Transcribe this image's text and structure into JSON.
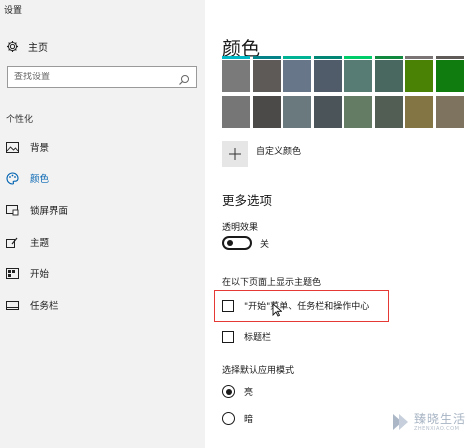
{
  "window": {
    "title": "设置"
  },
  "sidebar": {
    "home_label": "主页",
    "search_placeholder": "查找设置",
    "section_label": "个性化",
    "items": [
      {
        "label": "背景",
        "icon": "picture-icon"
      },
      {
        "label": "颜色",
        "icon": "palette-icon",
        "active": true
      },
      {
        "label": "锁屏界面",
        "icon": "lock-screen-icon"
      },
      {
        "label": "主题",
        "icon": "brush-icon"
      },
      {
        "label": "开始",
        "icon": "start-icon"
      },
      {
        "label": "任务栏",
        "icon": "taskbar-icon"
      }
    ]
  },
  "main": {
    "title": "颜色",
    "swatch_rows": [
      [
        {
          "color": "#7a7a7a",
          "stripe": "#00b7c3"
        },
        {
          "color": "#5d5a58",
          "stripe": "#038387"
        },
        {
          "color": "#68768a",
          "stripe": "#00b294"
        },
        {
          "color": "#515c6b",
          "stripe": "#018574"
        },
        {
          "color": "#567c73",
          "stripe": "#00cc6a"
        },
        {
          "color": "#486860",
          "stripe": "#10893e"
        },
        {
          "color": "#498205",
          "stripe": "#7a7574"
        },
        {
          "color": "#107c10",
          "stripe": "#5d5a58"
        }
      ],
      [
        {
          "color": "#767676",
          "stripe": ""
        },
        {
          "color": "#4c4a48",
          "stripe": ""
        },
        {
          "color": "#69797e",
          "stripe": ""
        },
        {
          "color": "#4a5459",
          "stripe": ""
        },
        {
          "color": "#647c64",
          "stripe": ""
        },
        {
          "color": "#525e54",
          "stripe": ""
        },
        {
          "color": "#847545",
          "stripe": ""
        },
        {
          "color": "#7e735f",
          "stripe": ""
        }
      ]
    ],
    "custom_color_label": "自定义颜色",
    "more_options_title": "更多选项",
    "transparency_label": "透明效果",
    "transparency_state": "关",
    "show_accent_label": "在以下页面上显示主题色",
    "checkbox_start": "\"开始\"菜单、任务栏和操作中心",
    "checkbox_titlebar": "标题栏",
    "app_mode_label": "选择默认应用模式",
    "radio_light": "亮",
    "radio_dark": "暗"
  },
  "watermark": {
    "cn": "臻晓生活",
    "en": "ZHENXIAO.COM"
  },
  "colors": {
    "accent": "#0063b1",
    "highlight": "#e53935"
  }
}
